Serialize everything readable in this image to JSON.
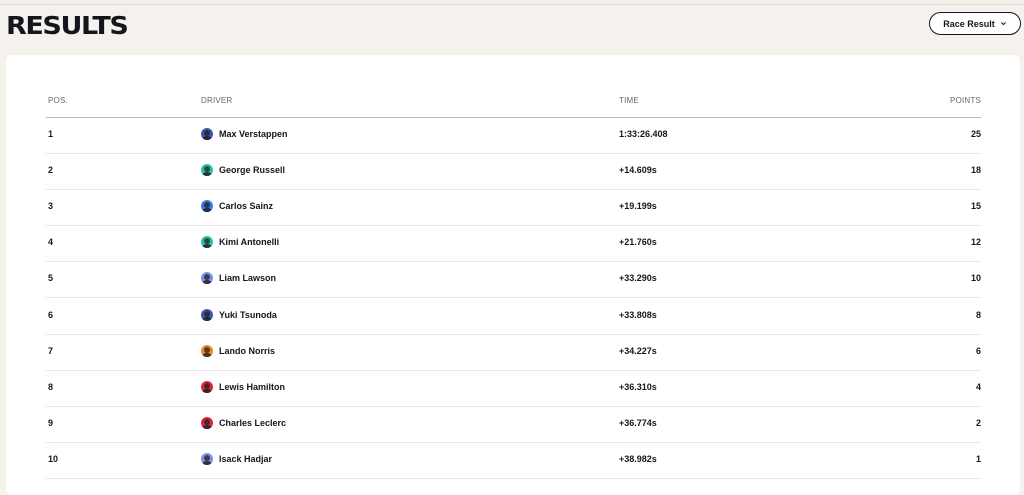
{
  "header": {
    "title": "RESULTS",
    "dropdown_label": "Race Result"
  },
  "table": {
    "columns": [
      "POS.",
      "DRIVER",
      "TIME",
      "POINTS"
    ],
    "rows": [
      {
        "pos": "1",
        "driver": "Max Verstappen",
        "time": "1:33:26.408",
        "points": "25",
        "team_color": "#3b5aa8"
      },
      {
        "pos": "2",
        "driver": "George Russell",
        "time": "+14.609s",
        "points": "18",
        "team_color": "#27c2a8"
      },
      {
        "pos": "3",
        "driver": "Carlos Sainz",
        "time": "+19.199s",
        "points": "15",
        "team_color": "#3a7be0"
      },
      {
        "pos": "4",
        "driver": "Kimi Antonelli",
        "time": "+21.760s",
        "points": "12",
        "team_color": "#27c2a8"
      },
      {
        "pos": "5",
        "driver": "Liam Lawson",
        "time": "+33.290s",
        "points": "10",
        "team_color": "#7d93e8"
      },
      {
        "pos": "6",
        "driver": "Yuki Tsunoda",
        "time": "+33.808s",
        "points": "8",
        "team_color": "#3b5aa8"
      },
      {
        "pos": "7",
        "driver": "Lando Norris",
        "time": "+34.227s",
        "points": "6",
        "team_color": "#f08a24"
      },
      {
        "pos": "8",
        "driver": "Lewis Hamilton",
        "time": "+36.310s",
        "points": "4",
        "team_color": "#d8283a"
      },
      {
        "pos": "9",
        "driver": "Charles Leclerc",
        "time": "+36.774s",
        "points": "2",
        "team_color": "#d8283a"
      },
      {
        "pos": "10",
        "driver": "Isack Hadjar",
        "time": "+38.982s",
        "points": "1",
        "team_color": "#7d93e8"
      }
    ]
  },
  "icons": {
    "dropdown": "chevron-down-icon",
    "avatar": "driver-avatar"
  }
}
